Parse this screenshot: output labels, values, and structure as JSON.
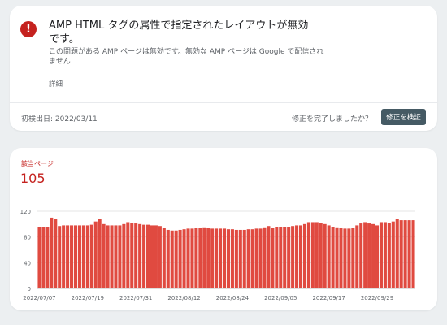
{
  "issue": {
    "icon": "error-exclamation-icon",
    "title": "AMP HTML タグの属性で指定されたレイアウトが無効です。",
    "description": "この問題がある AMP ページは無効です。無効な AMP ページは Google で配信されません",
    "details_link": "詳細",
    "first_detected": "初検出日: 2022/03/11",
    "fix_question": "修正を完了しましたか？",
    "validate_button": "修正を検証"
  },
  "summary": {
    "label": "該当ページ",
    "value": "105"
  },
  "colors": {
    "error_red": "#c5221f",
    "bar_red": "#e04a40",
    "button_bg": "#455a64"
  },
  "chart_data": {
    "type": "bar",
    "ylim": [
      0,
      120
    ],
    "yticks": [
      0,
      40,
      80,
      120
    ],
    "xtick_labels": [
      "2022/07/07",
      "2022/07/19",
      "2022/07/31",
      "2022/08/12",
      "2022/08/24",
      "2022/09/05",
      "2022/09/17",
      "2022/09/29"
    ],
    "grid": true,
    "values": [
      96,
      96,
      96,
      110,
      108,
      97,
      98,
      98,
      98,
      98,
      98,
      98,
      98,
      99,
      104,
      108,
      100,
      98,
      98,
      98,
      98,
      100,
      103,
      102,
      101,
      100,
      99,
      99,
      98,
      98,
      97,
      94,
      91,
      90,
      90,
      91,
      92,
      93,
      93,
      94,
      94,
      95,
      94,
      93,
      93,
      93,
      93,
      92,
      92,
      91,
      91,
      91,
      92,
      92,
      93,
      93,
      95,
      97,
      94,
      96,
      96,
      96,
      96,
      97,
      98,
      98,
      100,
      103,
      103,
      103,
      102,
      100,
      98,
      96,
      95,
      94,
      93,
      93,
      94,
      98,
      101,
      103,
      101,
      100,
      98,
      103,
      103,
      102,
      104,
      108,
      106,
      106,
      106,
      106
    ]
  }
}
